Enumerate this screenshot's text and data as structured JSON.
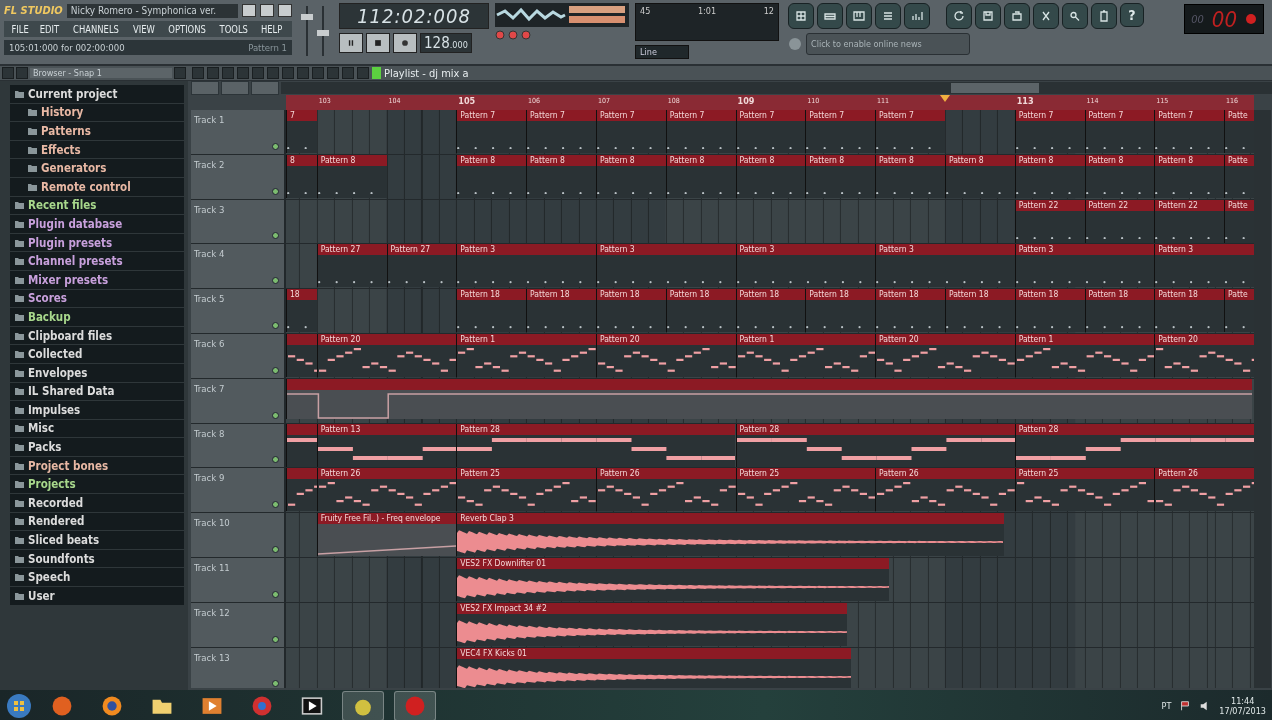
{
  "app": {
    "logo": "FL STUDIO",
    "title": "Nicky Romero - Symphonica ver.",
    "menu": [
      "FILE",
      "EDIT",
      "CHANNELS",
      "VIEW",
      "OPTIONS",
      "TOOLS",
      "HELP"
    ],
    "hint": "105:01:000 for 002:00:000",
    "hint_pattern": "Pattern 1"
  },
  "transport": {
    "time": "112:02:008",
    "tempo": "128",
    "tempo_fraction": ".000",
    "cpu": "45",
    "position": "1:01",
    "polyphony": "12",
    "snap": "Line",
    "help": "?",
    "counter": "00",
    "counter_small": "00"
  },
  "news": {
    "placeholder": "Click to enable online news"
  },
  "browser": {
    "title": "Browser - Snap 1",
    "items": [
      {
        "label": "Current project",
        "color": "#dcdcdc",
        "children": [
          {
            "label": "History",
            "color": "#e8b8a4"
          },
          {
            "label": "Patterns",
            "color": "#e8b8a4"
          },
          {
            "label": "Effects",
            "color": "#e8b8a4"
          },
          {
            "label": "Generators",
            "color": "#e8b8a4"
          },
          {
            "label": "Remote control",
            "color": "#e8b8a4"
          }
        ]
      },
      {
        "label": "Recent files",
        "color": "#a8d88c"
      },
      {
        "label": "Plugin database",
        "color": "#c8a0dc"
      },
      {
        "label": "Plugin presets",
        "color": "#c8a0dc"
      },
      {
        "label": "Channel presets",
        "color": "#c8a0dc"
      },
      {
        "label": "Mixer presets",
        "color": "#c8a0dc"
      },
      {
        "label": "Scores",
        "color": "#c8a0dc"
      },
      {
        "label": "Backup",
        "color": "#a8d88c"
      },
      {
        "label": "Clipboard files",
        "color": "#dcdcdc"
      },
      {
        "label": "Collected",
        "color": "#dcdcdc"
      },
      {
        "label": "Envelopes",
        "color": "#dcdcdc"
      },
      {
        "label": "IL Shared Data",
        "color": "#dcdcdc"
      },
      {
        "label": "Impulses",
        "color": "#dcdcdc"
      },
      {
        "label": "Misc",
        "color": "#dcdcdc"
      },
      {
        "label": "Packs",
        "color": "#dcdcdc"
      },
      {
        "label": "Project bones",
        "color": "#e8b8a4"
      },
      {
        "label": "Projects",
        "color": "#a8d88c"
      },
      {
        "label": "Recorded",
        "color": "#dcdcdc"
      },
      {
        "label": "Rendered",
        "color": "#dcdcdc"
      },
      {
        "label": "Sliced beats",
        "color": "#dcdcdc"
      },
      {
        "label": "Soundfonts",
        "color": "#dcdcdc"
      },
      {
        "label": "Speech",
        "color": "#dcdcdc"
      },
      {
        "label": "User",
        "color": "#dcdcdc"
      }
    ]
  },
  "playlist": {
    "title": "Playlist - dj mix a",
    "ruler": [
      {
        "label": "103",
        "major": false
      },
      {
        "label": "104",
        "major": false
      },
      {
        "label": "105",
        "major": true
      },
      {
        "label": "106",
        "major": false
      },
      {
        "label": "107",
        "major": false
      },
      {
        "label": "108",
        "major": false
      },
      {
        "label": "109",
        "major": true
      },
      {
        "label": "110",
        "major": false
      },
      {
        "label": "111",
        "major": false
      },
      {
        "label": "113",
        "major": true
      },
      {
        "label": "114",
        "major": false
      },
      {
        "label": "115",
        "major": false
      },
      {
        "label": "116",
        "major": false
      }
    ],
    "tracks": [
      {
        "name": "Track 1",
        "clips": [
          {
            "kind": "pattern",
            "name": "7"
          },
          {
            "kind": "pattern",
            "name": "Pattern 7"
          },
          {
            "kind": "pattern",
            "name": "Pattern 7"
          },
          {
            "kind": "pattern",
            "name": "Pattern 7"
          },
          {
            "kind": "pattern",
            "name": "Pattern 7"
          },
          {
            "kind": "pattern",
            "name": "Pattern 7"
          },
          {
            "kind": "pattern",
            "name": "Pattern 7"
          },
          {
            "kind": "pattern",
            "name": "Pattern 7"
          },
          {
            "kind": "pattern",
            "name": "Pattern 7"
          },
          {
            "kind": "pattern",
            "name": "Pattern 7"
          },
          {
            "kind": "pattern",
            "name": "Pattern 7"
          },
          {
            "kind": "pattern",
            "name": "Patte"
          }
        ]
      },
      {
        "name": "Track 2",
        "clips": [
          {
            "kind": "pattern",
            "name": "8"
          },
          {
            "kind": "pattern",
            "name": "Pattern 8"
          },
          {
            "kind": "pattern",
            "name": "Pattern 8"
          },
          {
            "kind": "pattern",
            "name": "Pattern 8"
          },
          {
            "kind": "pattern",
            "name": "Pattern 8"
          },
          {
            "kind": "pattern",
            "name": "Pattern 8"
          },
          {
            "kind": "pattern",
            "name": "Pattern 8"
          },
          {
            "kind": "pattern",
            "name": "Pattern 8"
          },
          {
            "kind": "pattern",
            "name": "Pattern 8"
          },
          {
            "kind": "pattern",
            "name": "Pattern 8"
          },
          {
            "kind": "pattern",
            "name": "Pattern 8"
          },
          {
            "kind": "pattern",
            "name": "Pattern 8"
          },
          {
            "kind": "pattern",
            "name": "Pattern 8"
          },
          {
            "kind": "pattern",
            "name": "Patte"
          }
        ]
      },
      {
        "name": "Track 3",
        "clips": [
          {
            "kind": "pattern",
            "name": "Pattern 22"
          },
          {
            "kind": "pattern",
            "name": "Pattern 22"
          },
          {
            "kind": "pattern",
            "name": "Pattern 22"
          },
          {
            "kind": "pattern",
            "name": "Patte"
          }
        ]
      },
      {
        "name": "Track 4",
        "clips": [
          {
            "kind": "pattern",
            "name": "Pattern 27"
          },
          {
            "kind": "pattern",
            "name": "Pattern 27"
          },
          {
            "kind": "pattern",
            "name": "Pattern 3"
          },
          {
            "kind": "pattern",
            "name": "Pattern 3"
          },
          {
            "kind": "pattern",
            "name": "Pattern 3"
          },
          {
            "kind": "pattern",
            "name": "Pattern 3"
          },
          {
            "kind": "pattern",
            "name": "Pattern 3"
          },
          {
            "kind": "pattern",
            "name": "Pattern 3"
          }
        ]
      },
      {
        "name": "Track 5",
        "clips": [
          {
            "kind": "pattern",
            "name": "18"
          },
          {
            "kind": "pattern",
            "name": "Pattern 18"
          },
          {
            "kind": "pattern",
            "name": "Pattern 18"
          },
          {
            "kind": "pattern",
            "name": "Pattern 18"
          },
          {
            "kind": "pattern",
            "name": "Pattern 18"
          },
          {
            "kind": "pattern",
            "name": "Pattern 18"
          },
          {
            "kind": "pattern",
            "name": "Pattern 18"
          },
          {
            "kind": "pattern",
            "name": "Pattern 18"
          },
          {
            "kind": "pattern",
            "name": "Pattern 18"
          },
          {
            "kind": "pattern",
            "name": "Pattern 18"
          },
          {
            "kind": "pattern",
            "name": "Pattern 18"
          },
          {
            "kind": "pattern",
            "name": "Pattern 18"
          },
          {
            "kind": "pattern",
            "name": "Patte"
          }
        ]
      },
      {
        "name": "Track 6",
        "clips": [
          {
            "kind": "melody"
          },
          {
            "kind": "melody",
            "name": "Pattern 20"
          },
          {
            "kind": "melody",
            "name": "Pattern 1"
          },
          {
            "kind": "melody",
            "name": "Pattern 20"
          },
          {
            "kind": "melody",
            "name": "Pattern 1"
          },
          {
            "kind": "melody",
            "name": "Pattern 20"
          },
          {
            "kind": "melody",
            "name": "Pattern 1"
          },
          {
            "kind": "melody",
            "name": "Pattern 20"
          }
        ]
      },
      {
        "name": "Track 7",
        "clips": [
          {
            "kind": "automation"
          }
        ]
      },
      {
        "name": "Track 8",
        "clips": [
          {
            "kind": "bass"
          },
          {
            "kind": "bass",
            "name": "Pattern 13"
          },
          {
            "kind": "bass",
            "name": "Pattern 28"
          },
          {
            "kind": "bass",
            "name": "Pattern 28"
          },
          {
            "kind": "bass",
            "name": "Pattern 28"
          }
        ]
      },
      {
        "name": "Track 9",
        "clips": [
          {
            "kind": "melody"
          },
          {
            "kind": "melody",
            "name": "Pattern 26"
          },
          {
            "kind": "melody",
            "name": "Pattern 25"
          },
          {
            "kind": "melody",
            "name": "Pattern 26"
          },
          {
            "kind": "melody",
            "name": "Pattern 25"
          },
          {
            "kind": "melody",
            "name": "Pattern 26"
          },
          {
            "kind": "melody",
            "name": "Pattern 25"
          },
          {
            "kind": "melody",
            "name": "Pattern 26"
          }
        ]
      },
      {
        "name": "Track 10",
        "clips": [
          {
            "kind": "automation",
            "name": "Fruity Free Fil..) - Freq envelope"
          },
          {
            "kind": "audio",
            "name": "Reverb Clap 3"
          }
        ]
      },
      {
        "name": "Track 11",
        "clips": [
          {
            "kind": "audio",
            "name": "VES2 FX Downlifter 01"
          }
        ]
      },
      {
        "name": "Track 12",
        "clips": [
          {
            "kind": "audio",
            "name": "VES2 FX Impact 34 #2"
          }
        ]
      },
      {
        "name": "Track 13",
        "clips": [
          {
            "kind": "audio",
            "name": "VEC4 FX Kicks 01"
          }
        ]
      }
    ]
  },
  "taskbar": {
    "language": "PT",
    "time": "11:44",
    "date": "17/07/2013"
  }
}
